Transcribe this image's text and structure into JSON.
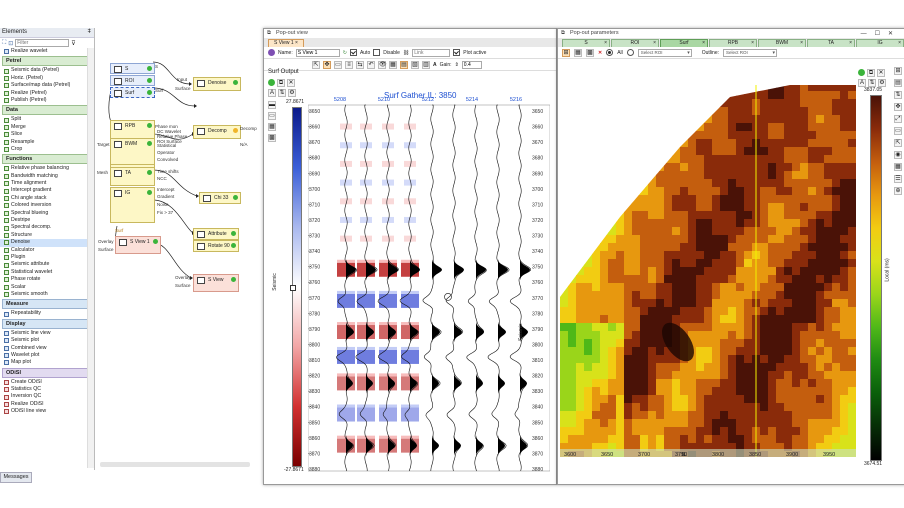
{
  "elements_panel": {
    "title": "Elements",
    "pin": "ǂ",
    "filter_placeholder": "Filter",
    "top_item": "Realize wavelet",
    "sections": [
      {
        "name": "Petrel",
        "color": "green",
        "items": [
          "Seismic data (Petrel)",
          "Horiz. (Petrel)",
          "Surface/map data (Petrel)",
          "Realize (Petrel)",
          "Publish (Petrel)"
        ]
      },
      {
        "name": "Data",
        "color": "green",
        "items": [
          "Split",
          "Merge",
          "Slice",
          "Resample",
          "Crop"
        ]
      },
      {
        "name": "Functions",
        "color": "green",
        "items": [
          "Relative phase balancing",
          "Bandwidth matching",
          "Time alignment",
          "Intercept gradient",
          "Chi angle stack",
          "Colored inversion",
          "Spectral blueing",
          "Destripe",
          "Spectral decomp.",
          "Structure",
          "Denoise",
          "Calculator",
          "Plugin",
          "Seismic attribute",
          "Statistical wavelet",
          "Phase rotate",
          "Scalar",
          "Seismic smooth"
        ]
      },
      {
        "name": "Measure",
        "color": "blue",
        "items": [
          "Repeatability"
        ]
      },
      {
        "name": "Display",
        "color": "blue",
        "items": [
          "Seismic line view",
          "Seismic plot",
          "Combined view",
          "Wavelet plot",
          "Map plot"
        ]
      },
      {
        "name": "ODiSI",
        "color": "purple",
        "items": [
          "Create ODiSI",
          "Statistics QC",
          "Inversion QC",
          "Realize ODiSI",
          "ODiSI line view"
        ]
      }
    ],
    "selected_item": "Denoise",
    "messages_tab": "Messages"
  },
  "graph": {
    "nodes": [
      {
        "id": "s",
        "label": "S",
        "ports_out": [
          "S"
        ]
      },
      {
        "id": "roi",
        "label": "ROI"
      },
      {
        "id": "surf",
        "label": "Surf",
        "ports_out": [
          "Surf"
        ]
      },
      {
        "id": "denoise",
        "label": "Denoise",
        "ports_in": [
          "Input",
          "Surface"
        ]
      },
      {
        "id": "rpb",
        "label": "RPB",
        "ports_out": [
          "Phase mon",
          "DC Wavelet",
          "Relative Phase",
          "ROI Surface"
        ]
      },
      {
        "id": "decomp",
        "label": "Decomp",
        "ports_out": [
          "Decomp",
          "N/A"
        ]
      },
      {
        "id": "bwm",
        "label": "BWM",
        "ports_in": [
          "Target"
        ],
        "ports_out": [
          "Statistical",
          "Operator",
          "Convolved"
        ]
      },
      {
        "id": "ta",
        "label": "TA",
        "ports_in": [
          "Mesh"
        ],
        "ports_out": [
          "Time shifts",
          "NCC"
        ]
      },
      {
        "id": "ig",
        "label": "IG",
        "ports_out": [
          "Intercept",
          "Gradient",
          "Noise",
          "Fix > 37"
        ]
      },
      {
        "id": "chi",
        "label": "Chi 33"
      },
      {
        "id": "sview",
        "label": "S View 1",
        "ports_in": [
          "Overlay",
          "Surface"
        ]
      },
      {
        "id": "attr",
        "label": "Attribute"
      },
      {
        "id": "rot",
        "label": "Rotate 90"
      },
      {
        "id": "sview2",
        "label": "S View",
        "ports_in": [
          "Overlay",
          "Surface"
        ]
      }
    ],
    "small_label": "Surf"
  },
  "popview": {
    "title": "Pop-out view",
    "tabs": [
      "S View 1"
    ],
    "name_label": "Name:",
    "name_value": "S View 1",
    "auto_label": "Auto",
    "auto_checked": true,
    "disable_label": "Disable",
    "disable_checked": false,
    "link_placeholder": "Link",
    "plot_active_label": "Plot active",
    "plot_active_checked": true,
    "gain_label": "Gain:",
    "gain_value": "0.4",
    "layer_label": "Surf Output",
    "colorbar_max": "27.8671",
    "colorbar_min": "-27.8671",
    "colorbar_axis_label": "Seismic",
    "plot_title": "Surf Gather   IL: 3850",
    "xline_labels": [
      "5208",
      "5210",
      "5212",
      "5214",
      "5216",
      "5218"
    ],
    "time_labels": [
      "3650",
      "3660",
      "3670",
      "3680",
      "3690",
      "3700",
      "3710",
      "3720",
      "3730",
      "3740",
      "3750",
      "3760",
      "3770",
      "3780",
      "3790",
      "3800",
      "3810",
      "3820",
      "3830",
      "3840",
      "3850",
      "3860",
      "3870",
      "3880"
    ],
    "right_axis_label": "Seismic"
  },
  "popparams": {
    "title": "Pop-out parameters",
    "tabs": [
      "S",
      "ROI",
      "Surf",
      "RPB",
      "BWM",
      "TA",
      "IG"
    ],
    "active_tab": "Surf",
    "radio_all": "All",
    "select_roi": "Select ROI",
    "outline_label": "Outline:",
    "select_roi2": "Select ROI",
    "x_labels": [
      "3600",
      "3650",
      "3700",
      "3750",
      "3800",
      "3850",
      "3900",
      "3950"
    ],
    "colorbar_max": "3837.05",
    "colorbar_min": "3674.51",
    "colorbar_axis_label": "Local (ms)"
  },
  "colors": {
    "accent_orange": "#fde1b8",
    "green_tab": "#a9d7a3",
    "seismic_red": "#b00000",
    "seismic_blue": "#1a2fc8"
  }
}
